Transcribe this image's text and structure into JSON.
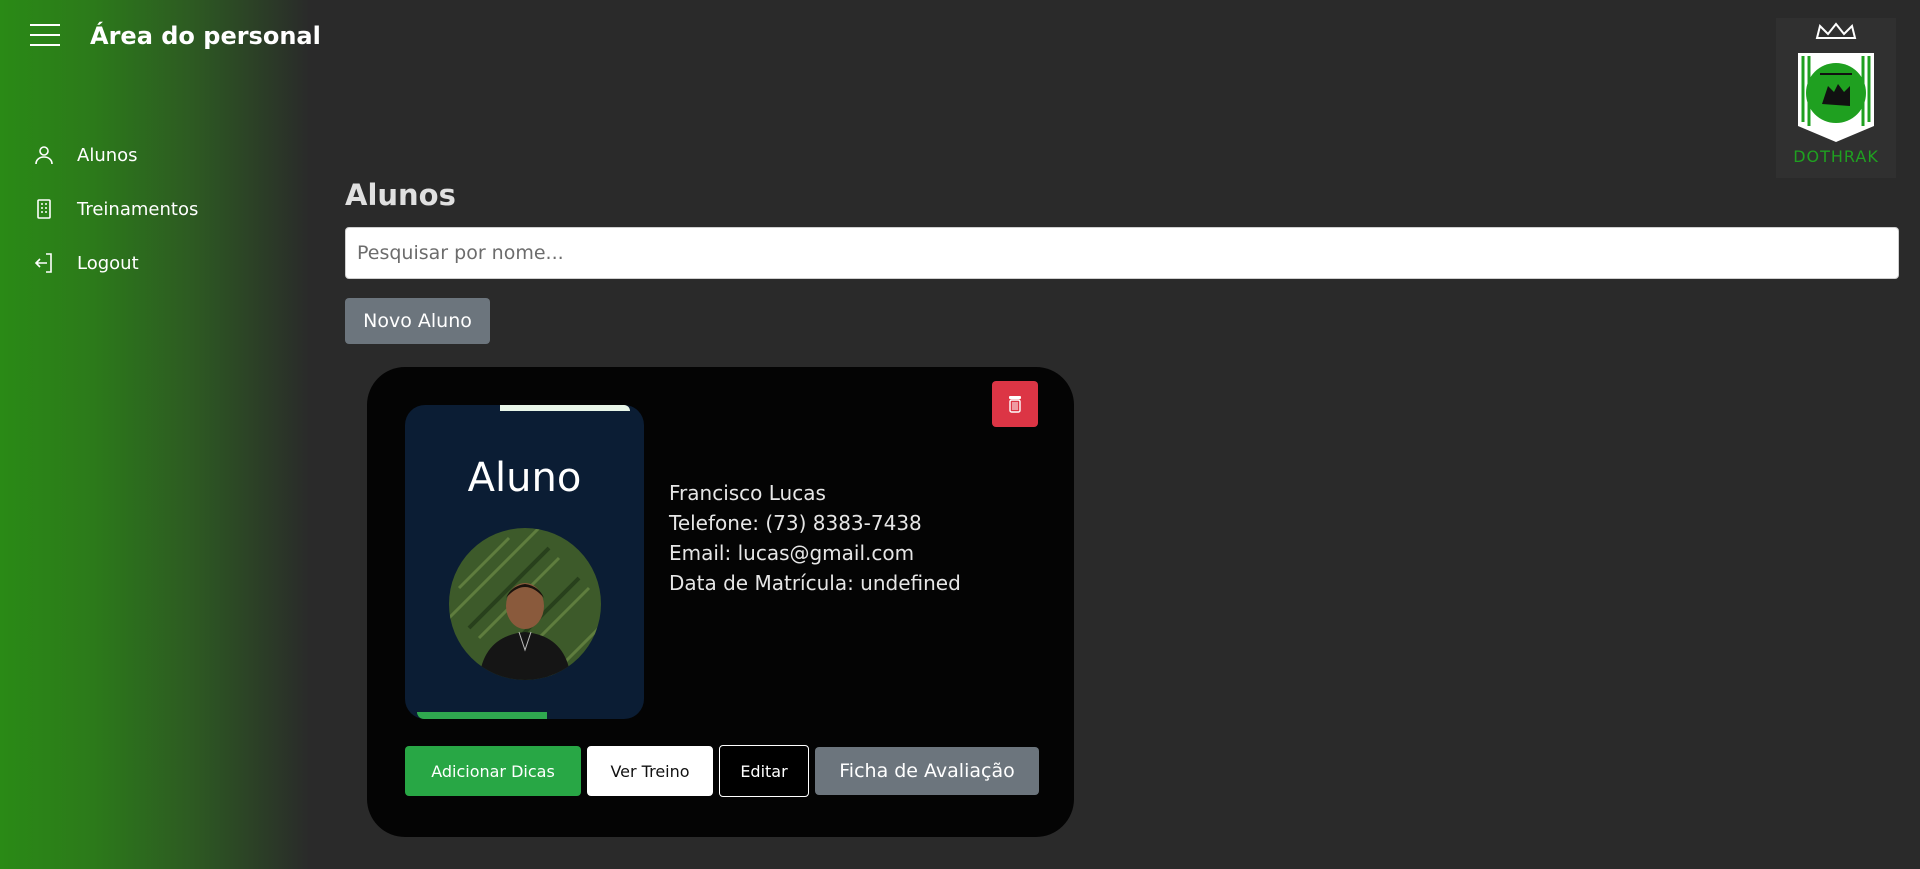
{
  "sidebar": {
    "title": "Área do personal",
    "items": [
      {
        "label": "Alunos",
        "icon": "user-icon"
      },
      {
        "label": "Treinamentos",
        "icon": "building-icon"
      },
      {
        "label": "Logout",
        "icon": "logout-icon"
      }
    ]
  },
  "logo": {
    "text": "DOTHRAK"
  },
  "main": {
    "title": "Alunos",
    "search": {
      "placeholder": "Pesquisar por nome...",
      "value": ""
    },
    "new_button": "Novo Aluno"
  },
  "student_card": {
    "panel_title": "Aluno",
    "name": "Francisco Lucas",
    "phone": "Telefone: (73) 8383-7438",
    "email": "Email: lucas@gmail.com",
    "enrollment": "Data de Matrícula: undefined",
    "actions": {
      "add_tips": "Adicionar Dicas",
      "view_training": "Ver Treino",
      "edit": "Editar",
      "evaluation": "Ficha de Avaliação"
    }
  },
  "colors": {
    "accent_green": "#28a745",
    "danger": "#dc3545",
    "secondary": "#6c757d",
    "sidebar_green": "#2a8a16"
  }
}
